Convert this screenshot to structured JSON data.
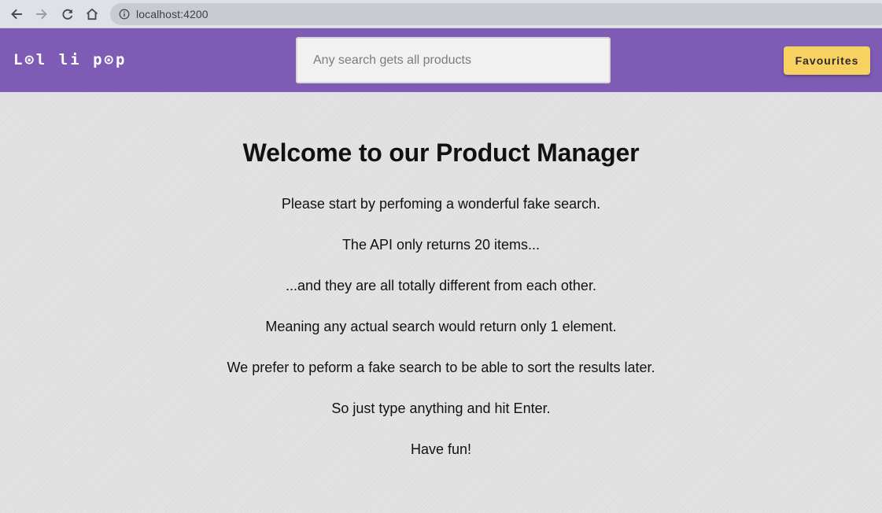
{
  "browser": {
    "url": "localhost:4200",
    "icons": [
      "back-arrow-icon",
      "forward-arrow-icon",
      "reload-icon",
      "home-icon",
      "info-icon"
    ]
  },
  "header": {
    "logo": "L⊙l li p⊙p",
    "search_placeholder": "Any search gets all products",
    "search_value": "",
    "favourites_label": "Favourites"
  },
  "main": {
    "title": "Welcome to our Product Manager",
    "lines": [
      "Please start by perfoming a wonderful fake search.",
      "The API only returns 20 items...",
      "...and they are all totally different from each other.",
      "Meaning any actual search would return only 1 element.",
      "We prefer to peform a fake search to be able to sort the results later.",
      "So just type anything and hit Enter.",
      "Have fun!"
    ]
  },
  "colors": {
    "header_bg": "#7e5bb4",
    "button_bg": "#f7d261",
    "page_bg": "#e1e1e1",
    "text": "#111111"
  }
}
